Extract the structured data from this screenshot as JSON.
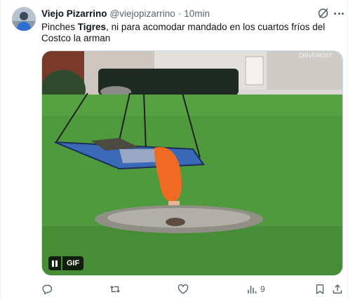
{
  "post": {
    "author_name": "Viejo Pizarrino",
    "author_handle": "@viejopizarrino",
    "separator": "·",
    "time": "10min",
    "text_before": "Pinches ",
    "text_bold": "Tigres",
    "text_after": ", ni para acomodar mandado en los cuartos fríos del Costco la arman",
    "media_watermark": "DRIVEMOST",
    "gif_label": "GIF"
  },
  "actions": {
    "reply_count": "",
    "repost_count": "",
    "like_count": "",
    "views_count": "9"
  },
  "icons": {
    "avatar": "avatar-image",
    "grok": "grok-icon",
    "more": "more-icon",
    "pause": "pause-icon",
    "reply": "reply-icon",
    "repost": "repost-icon",
    "like": "like-icon",
    "views": "views-icon",
    "bookmark": "bookmark-icon",
    "share": "share-icon"
  },
  "colors": {
    "text_primary": "#0f1419",
    "text_secondary": "#536471",
    "border": "#cfd9de"
  }
}
